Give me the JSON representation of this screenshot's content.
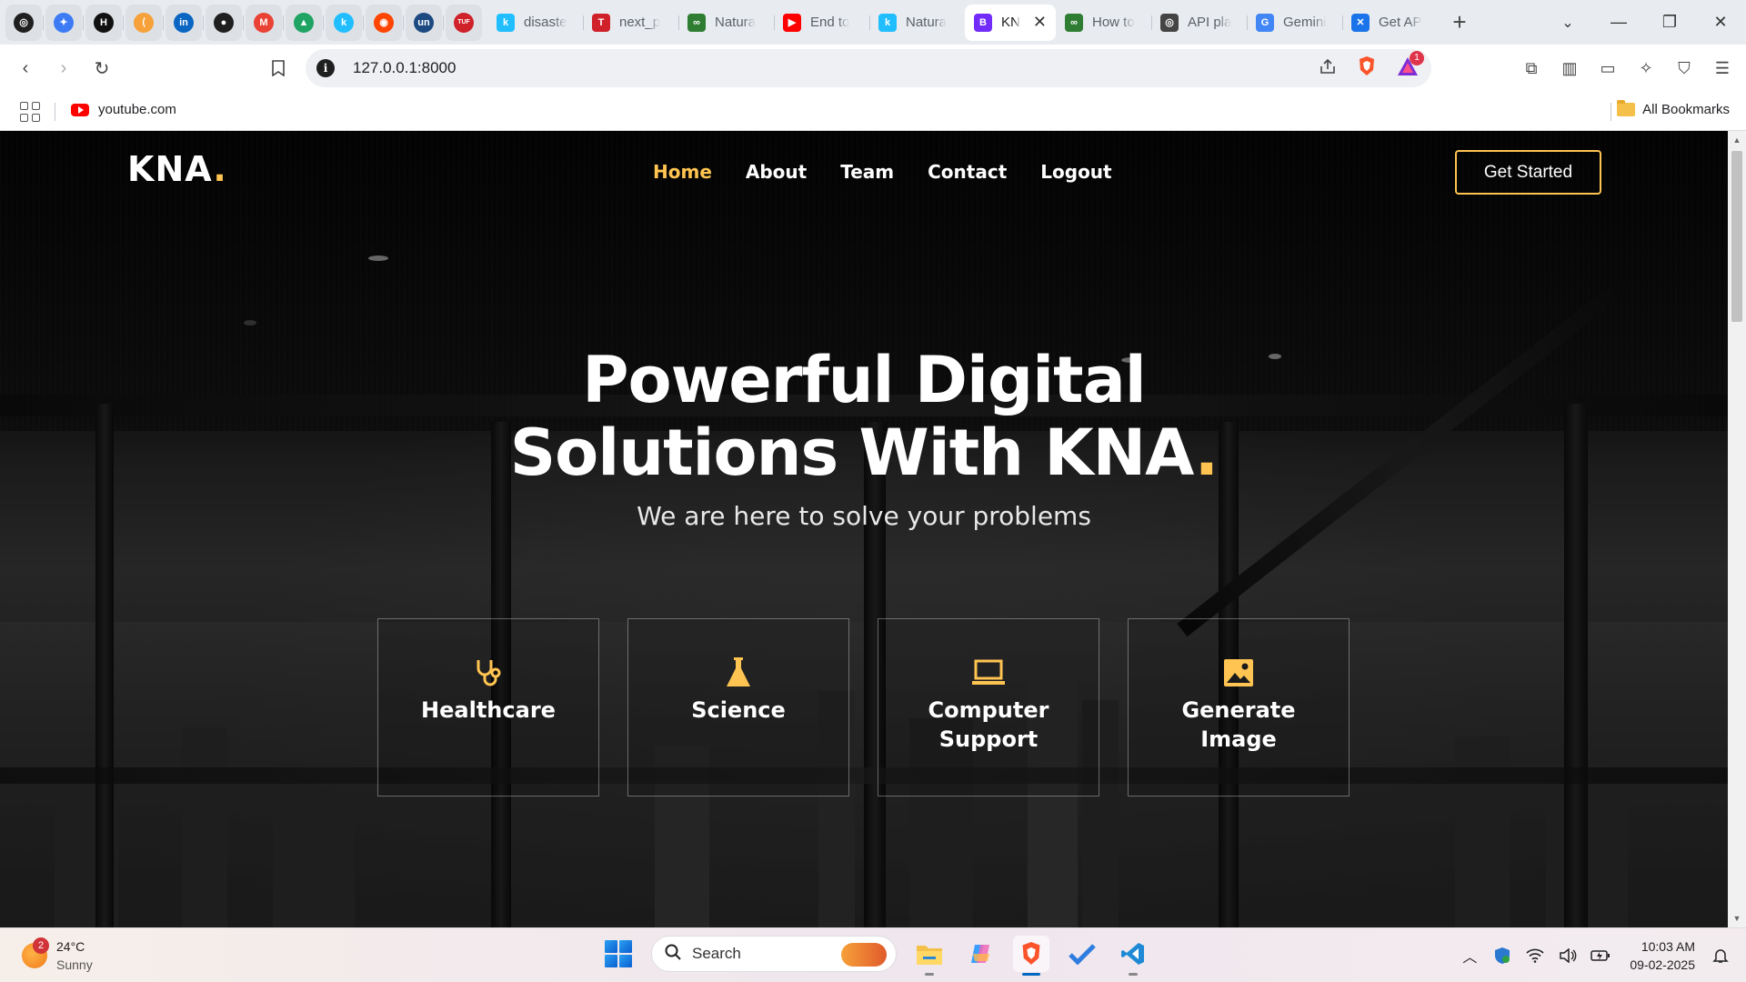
{
  "browser": {
    "pinned_tabs": [
      {
        "icon": "openai-icon",
        "color": "#1f1f1f",
        "glyph": "◎"
      },
      {
        "icon": "gemini-sparkle-icon",
        "color": "#3d7bf5",
        "glyph": "✦"
      },
      {
        "icon": "hackerrank-icon",
        "color": "#111111",
        "glyph": "H"
      },
      {
        "icon": "leetcode-icon",
        "color": "#f6a13a",
        "glyph": "⟨"
      },
      {
        "icon": "linkedin-icon",
        "color": "#0a66c2",
        "glyph": "in"
      },
      {
        "icon": "github-icon",
        "color": "#1f1f1f",
        "glyph": "●"
      },
      {
        "icon": "gmail-icon",
        "color": "#ea4335",
        "glyph": "M"
      },
      {
        "icon": "google-drive-icon",
        "color": "#1fa463",
        "glyph": "▲"
      },
      {
        "icon": "kaggle-icon",
        "color": "#20beff",
        "glyph": "k"
      },
      {
        "icon": "reddit-icon",
        "color": "#ff4500",
        "glyph": "◉"
      },
      {
        "icon": "unstop-icon",
        "color": "#1c4980",
        "glyph": "un"
      },
      {
        "icon": "takeuforward-icon",
        "color": "#d0202a",
        "glyph": "TUF"
      }
    ],
    "tabs": [
      {
        "title": "disaste",
        "icon": "kaggle-icon",
        "color": "#20beff",
        "glyph": "k"
      },
      {
        "title": "next_p",
        "icon": "takeuforward-icon",
        "color": "#d0202a",
        "glyph": "T"
      },
      {
        "title": "Natura",
        "icon": "huggingface-icon",
        "color": "#2e7d32",
        "glyph": "∞"
      },
      {
        "title": "End to",
        "icon": "youtube-icon",
        "color": "#ff0000",
        "glyph": "▶"
      },
      {
        "title": "Natura",
        "icon": "kaggle-icon",
        "color": "#20beff",
        "glyph": "k"
      },
      {
        "title": "KN",
        "icon": "bootstrap-icon",
        "color": "#712cf9",
        "glyph": "B",
        "active": true
      },
      {
        "title": "How to",
        "icon": "huggingface-icon",
        "color": "#2e7d32",
        "glyph": "∞"
      },
      {
        "title": "API pla",
        "icon": "openai-icon",
        "color": "#444444",
        "glyph": "◎"
      },
      {
        "title": "Gemini",
        "icon": "google-icon",
        "color": "#4285f4",
        "glyph": "G"
      },
      {
        "title": "Get AP",
        "icon": "ai-studio-icon",
        "color": "#1a73e8",
        "glyph": "✕"
      }
    ],
    "url": "127.0.0.1:8000",
    "brave_rewards_badge": "1",
    "bookmarks": {
      "item": "youtube.com",
      "all": "All Bookmarks"
    }
  },
  "site": {
    "logo": "KNA",
    "logo_dot": ".",
    "nav": [
      "Home",
      "About",
      "Team",
      "Contact",
      "Logout"
    ],
    "nav_current": "Home",
    "cta": "Get Started",
    "hero_line1": "Powerful Digital",
    "hero_line2": "Solutions With KNA",
    "hero_dot": ".",
    "hero_sub": "We are here to solve your problems",
    "cards": [
      {
        "label": "Healthcare",
        "icon": "stethoscope-icon"
      },
      {
        "label": "Science",
        "icon": "flask-icon"
      },
      {
        "label": "Computer Support",
        "icon": "laptop-icon"
      },
      {
        "label": "Generate Image",
        "icon": "image-icon"
      }
    ],
    "accent": "#ffc451"
  },
  "taskbar": {
    "weather_temp": "24°C",
    "weather_desc": "Sunny",
    "weather_badge": "2",
    "search_placeholder": "Search",
    "apps": [
      {
        "name": "file-explorer-icon",
        "active": false
      },
      {
        "name": "copilot-icon",
        "active": false
      },
      {
        "name": "brave-icon",
        "active": true
      },
      {
        "name": "todo-icon",
        "active": false
      },
      {
        "name": "vscode-icon",
        "active": false
      }
    ],
    "time": "10:03 AM",
    "date": "09-02-2025"
  }
}
